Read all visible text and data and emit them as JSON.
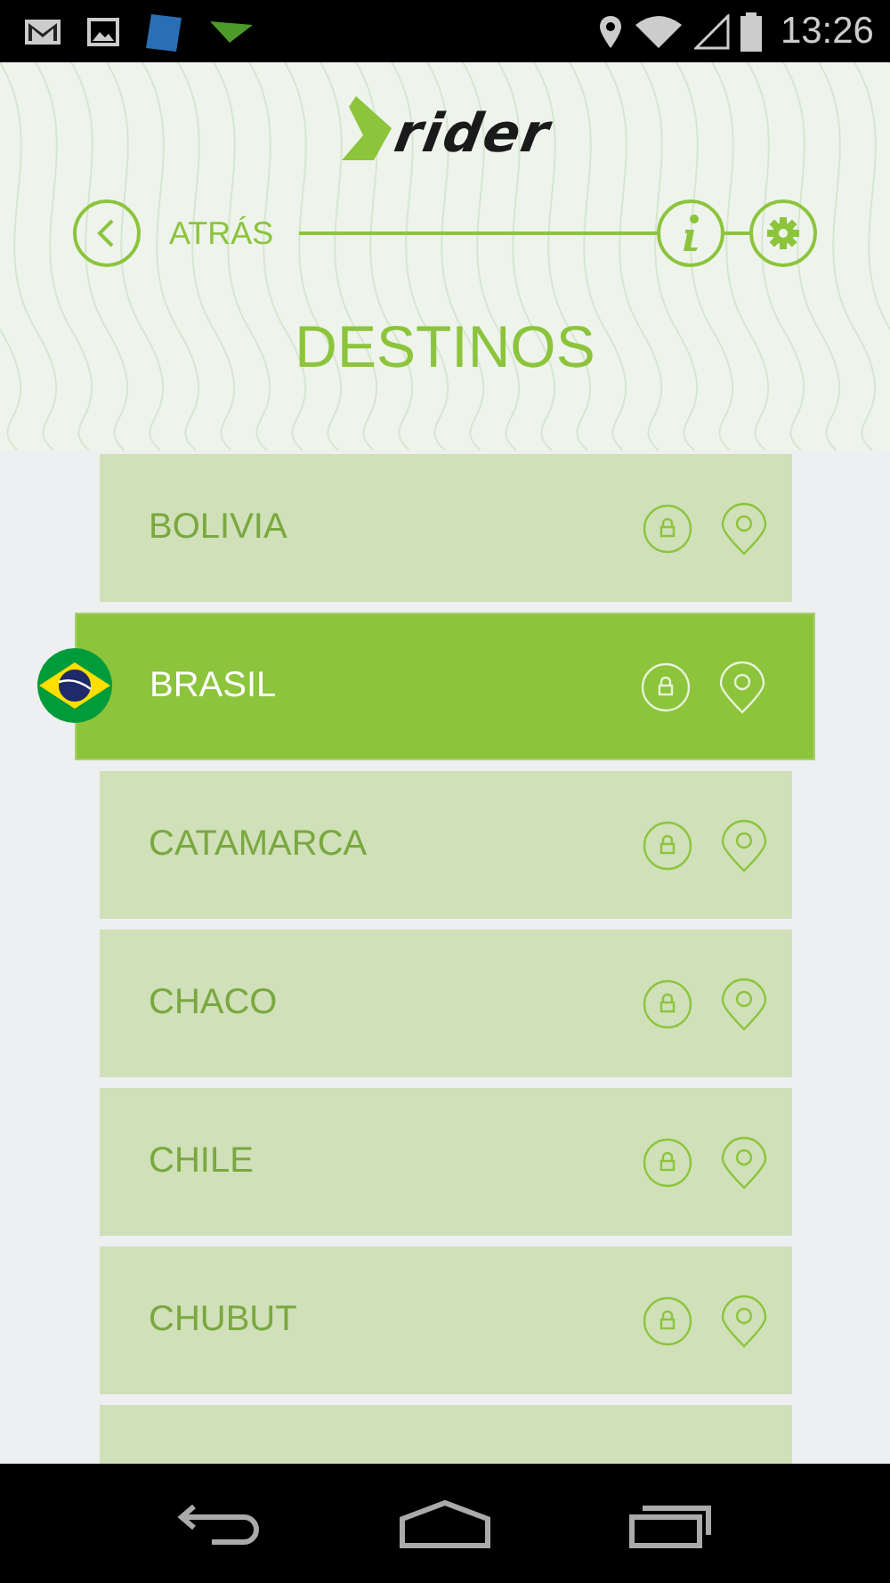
{
  "status_bar": {
    "time": "13:26"
  },
  "header": {
    "logo": "rider",
    "back_label": "ATRÁS",
    "title": "DESTINOS"
  },
  "destinations": [
    {
      "name": "BOLIVIA",
      "selected": false
    },
    {
      "name": "BRASIL",
      "selected": true
    },
    {
      "name": "CATAMARCA",
      "selected": false
    },
    {
      "name": "CHACO",
      "selected": false
    },
    {
      "name": "CHILE",
      "selected": false
    },
    {
      "name": "CHUBUT",
      "selected": false
    }
  ]
}
